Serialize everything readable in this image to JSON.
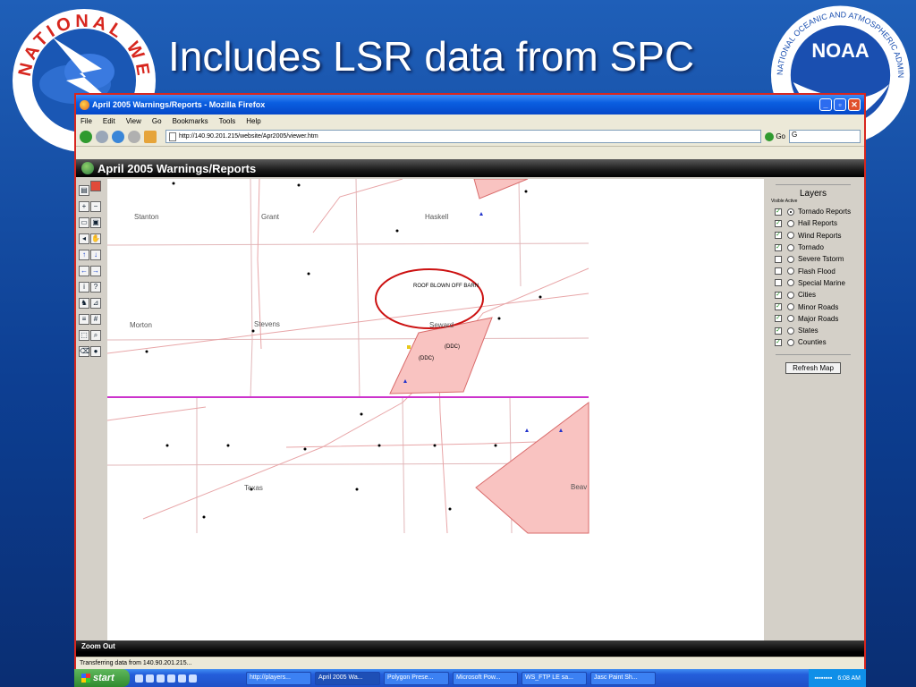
{
  "slide": {
    "title": "Includes LSR data from SPC",
    "nws_logo_text": "NATIONAL WEATHER SERVICE",
    "noaa_logo_text": "NOAA",
    "noaa_ring_text": "NATIONAL OCEANIC AND ATMOSPHERIC ADMINISTRATION"
  },
  "browser": {
    "window_title": "April 2005 Warnings/Reports - Mozilla Firefox",
    "menu": [
      "File",
      "Edit",
      "View",
      "Go",
      "Bookmarks",
      "Tools",
      "Help"
    ],
    "url": "http://140.90.201.215/website/Apr2005/viewer.htm",
    "go_label": "Go",
    "search_value": "G",
    "status_text": "Transferring data from 140.90.201.215..."
  },
  "app": {
    "header_title": "April 2005 Warnings/Reports",
    "footer_text": "Zoom Out",
    "tools": [
      "legend-icon",
      "layer-list-icon",
      "zoom-in-icon",
      "zoom-out-icon",
      "print-icon",
      "save-icon",
      "back-icon",
      "pan-icon",
      "pan-up-icon",
      "pan-down-icon",
      "pan-left-icon",
      "pan-right-icon",
      "identify-icon",
      "query-icon",
      "find-icon",
      "measure-icon",
      "select-list-icon",
      "buffer-icon",
      "select-icon",
      "search-icon",
      "clear-icon",
      "overview-icon"
    ]
  },
  "map": {
    "places": [
      "Stanton",
      "Grant",
      "Haskell",
      "Morton",
      "Stevens",
      "Seward",
      "Texas",
      "Beav"
    ],
    "report_label": "ROOF BLOWN OFF BARN",
    "ddc_labels": [
      "(DDC)",
      "(DDC)"
    ],
    "warning_fill": "#f9c3c1",
    "warning_stroke": "#d96b6b",
    "state_line_color": "#cc33cc",
    "highlight_circle_color": "#cc1111"
  },
  "layers": {
    "title": "Layers",
    "subtitle": "Visible Active",
    "items": [
      {
        "label": "Tornado Reports",
        "checked": true,
        "active": true
      },
      {
        "label": "Hail Reports",
        "checked": true,
        "active": false
      },
      {
        "label": "Wind Reports",
        "checked": true,
        "active": false
      },
      {
        "label": "Tornado",
        "checked": true,
        "active": false
      },
      {
        "label": "Severe Tstorm",
        "checked": false,
        "active": false
      },
      {
        "label": "Flash Flood",
        "checked": false,
        "active": false
      },
      {
        "label": "Special Marine",
        "checked": false,
        "active": false
      },
      {
        "label": "Cities",
        "checked": true,
        "active": false
      },
      {
        "label": "Minor Roads",
        "checked": true,
        "active": false
      },
      {
        "label": "Major Roads",
        "checked": true,
        "active": false
      },
      {
        "label": "States",
        "checked": true,
        "active": false
      },
      {
        "label": "Counties",
        "checked": true,
        "active": false
      }
    ],
    "refresh_label": "Refresh Map"
  },
  "taskbar": {
    "start_label": "start",
    "tasks": [
      {
        "label": "http://players...",
        "active": false
      },
      {
        "label": "April 2005 Wa...",
        "active": true
      },
      {
        "label": "Polygon Prese...",
        "active": false
      },
      {
        "label": "Microsoft Pow...",
        "active": false
      },
      {
        "label": "WS_FTP LE sa...",
        "active": false
      },
      {
        "label": "Jasc Paint Sh...",
        "active": false
      }
    ],
    "clock": "6:08 AM"
  }
}
